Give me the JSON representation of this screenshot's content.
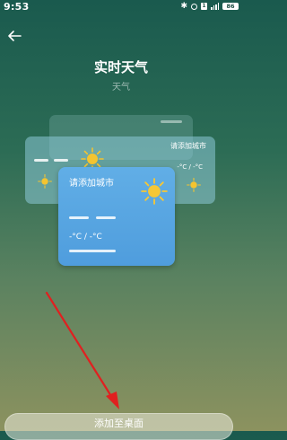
{
  "status_bar": {
    "time": "9:53",
    "battery": "86"
  },
  "header": {
    "title": "实时天气",
    "subtitle": "天气"
  },
  "widget_preview": {
    "middle_card": {
      "city": "请添加城市",
      "temp": "-°C / -°C"
    },
    "front_card": {
      "city": "请添加城市",
      "temp": "-°C / -°C"
    },
    "weather_icon": "sun-icon"
  },
  "footer": {
    "add_button_label": "添加至桌面"
  },
  "colors": {
    "card_blue": "#5aa6e2",
    "arrow_red": "#e02020"
  }
}
